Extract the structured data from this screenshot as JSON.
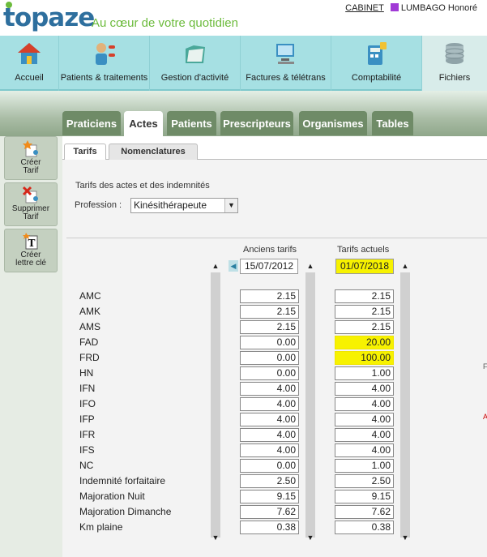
{
  "header": {
    "logo": "topaze",
    "slogan": "Au cœur de votre quotidien",
    "cabinet_link": "CABINET",
    "user": "LUMBAGO Honoré",
    "user_color": "#a13ad6"
  },
  "nav": [
    {
      "label": "Accueil",
      "icon": "house-icon"
    },
    {
      "label": "Patients & traitements",
      "icon": "patients-icon"
    },
    {
      "label": "Gestion d'activité",
      "icon": "folder-icon"
    },
    {
      "label": "Factures & télétrans",
      "icon": "computer-icon"
    },
    {
      "label": "Comptabilité",
      "icon": "calculator-icon"
    },
    {
      "label": "Fichiers",
      "icon": "database-icon"
    }
  ],
  "sidebar": [
    {
      "label_line1": "Créer",
      "label_line2": "Tarif",
      "icon": "create-star-icon"
    },
    {
      "label_line1": "Supprimer",
      "label_line2": "Tarif",
      "icon": "delete-x-icon"
    },
    {
      "label_line1": "Créer",
      "label_line2": "lettre clé",
      "icon": "text-t-icon"
    }
  ],
  "tabs": [
    "Praticiens",
    "Actes",
    "Patients",
    "Prescripteurs",
    "Organismes",
    "Tables"
  ],
  "active_tab": "Actes",
  "subtabs": [
    "Tarifs",
    "Nomenclatures"
  ],
  "active_subtab": "Tarifs",
  "panel": {
    "title": "Tarifs des actes et des indemnités",
    "profession_label": "Profession :",
    "profession_value": "Kinésithérapeute",
    "col_old": "Anciens tarifs",
    "col_new": "Tarifs actuels",
    "date_old": "15/07/2012",
    "date_new": "01/07/2018",
    "highlight_color": "#f7f200"
  },
  "rows": [
    {
      "label": "AMC",
      "old": "2.15",
      "new": "2.15",
      "hl": false
    },
    {
      "label": "AMK",
      "old": "2.15",
      "new": "2.15",
      "hl": false
    },
    {
      "label": "AMS",
      "old": "2.15",
      "new": "2.15",
      "hl": false
    },
    {
      "label": "FAD",
      "old": "0.00",
      "new": "20.00",
      "hl": true
    },
    {
      "label": "FRD",
      "old": "0.00",
      "new": "100.00",
      "hl": true
    },
    {
      "label": "HN",
      "old": "0.00",
      "new": "1.00",
      "hl": false
    },
    {
      "label": "IFN",
      "old": "4.00",
      "new": "4.00",
      "hl": false
    },
    {
      "label": "IFO",
      "old": "4.00",
      "new": "4.00",
      "hl": false
    },
    {
      "label": "IFP",
      "old": "4.00",
      "new": "4.00",
      "hl": false
    },
    {
      "label": "IFR",
      "old": "4.00",
      "new": "4.00",
      "hl": false
    },
    {
      "label": "IFS",
      "old": "4.00",
      "new": "4.00",
      "hl": false
    },
    {
      "label": "NC",
      "old": "0.00",
      "new": "1.00",
      "hl": false
    },
    {
      "label": "Indemnité forfaitaire",
      "old": "2.50",
      "new": "2.50",
      "hl": false
    },
    {
      "label": "Majoration Nuit",
      "old": "9.15",
      "new": "9.15",
      "hl": false
    },
    {
      "label": "Majoration Dimanche",
      "old": "7.62",
      "new": "7.62",
      "hl": false
    },
    {
      "label": "Km plaine",
      "old": "0.38",
      "new": "0.38",
      "hl": false
    }
  ],
  "edge_text": {
    "a": "F",
    "b": "A"
  }
}
